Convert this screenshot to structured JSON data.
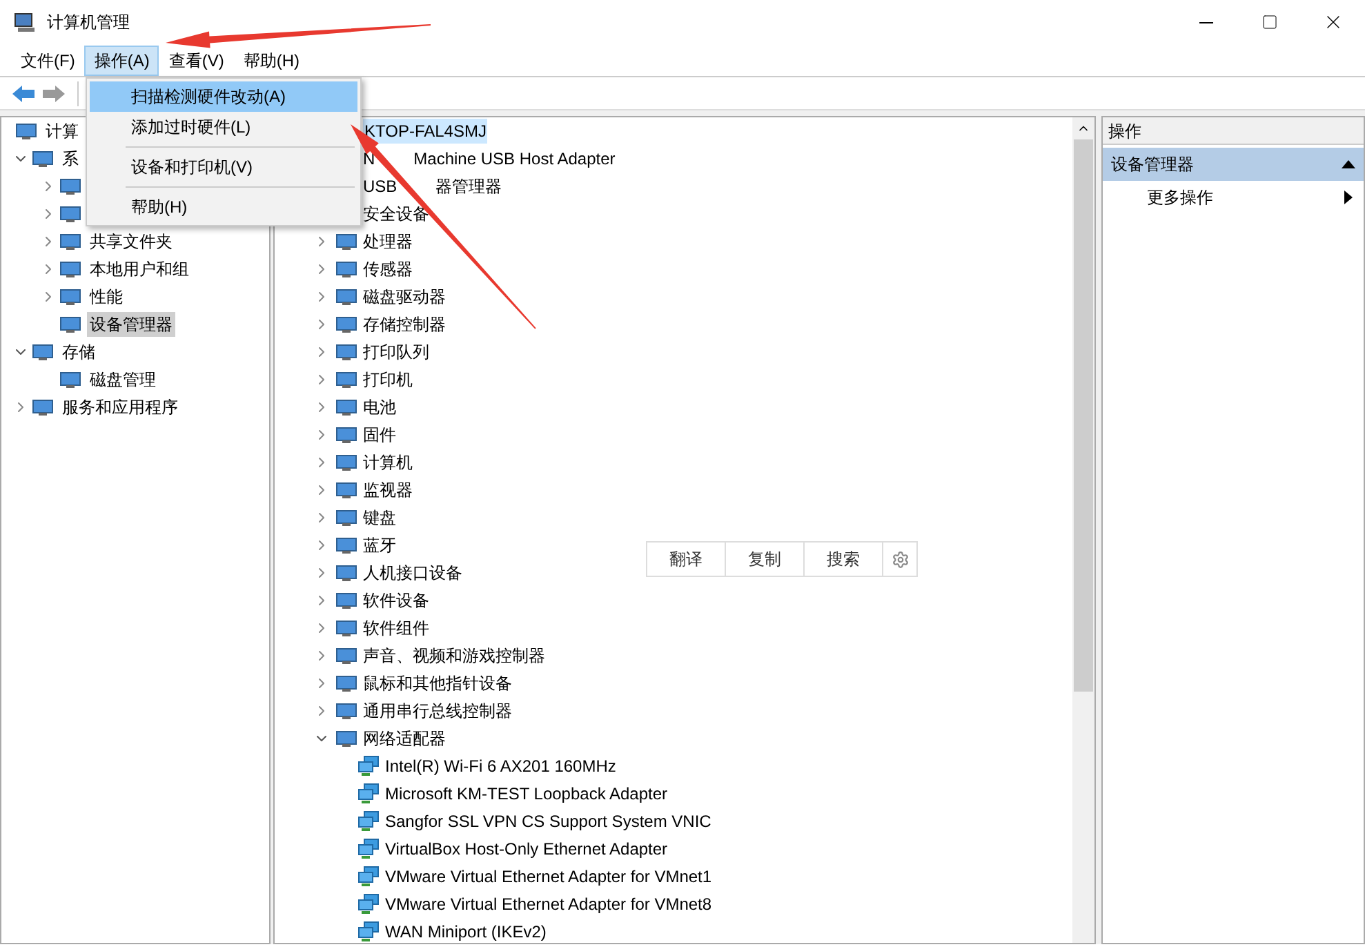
{
  "window": {
    "title": "计算机管理"
  },
  "menu_bar": [
    {
      "label": "文件(F)",
      "selected": false
    },
    {
      "label": "操作(A)",
      "selected": true
    },
    {
      "label": "查看(V)",
      "selected": false
    },
    {
      "label": "帮助(H)",
      "selected": false
    }
  ],
  "dropdown_menu": {
    "items": [
      {
        "kind": "item",
        "label": "扫描检测硬件改动(A)",
        "selected": true
      },
      {
        "kind": "item",
        "label": "添加过时硬件(L)",
        "selected": false
      },
      {
        "kind": "separator"
      },
      {
        "kind": "item",
        "label": "设备和打印机(V)",
        "selected": false
      },
      {
        "kind": "separator"
      },
      {
        "kind": "item",
        "label": "帮助(H)",
        "selected": false
      }
    ]
  },
  "left_tree": [
    {
      "label": "计算",
      "selected": false,
      "children": [
        {
          "label": "系",
          "expanded": true,
          "selected": false,
          "children": [
            {
              "expanded": false
            },
            {
              "expanded": false
            },
            {
              "label": "共享文件夹",
              "expanded": false,
              "selected": false
            },
            {
              "label": "本地用户和组",
              "expanded": false,
              "selected": false
            },
            {
              "label": "性能",
              "expanded": false,
              "selected": false
            },
            {
              "label": "设备管理器",
              "selected": true
            }
          ]
        },
        {
          "label": "存储",
          "expanded": true,
          "selected": false,
          "children": [
            {
              "label": "磁盘管理",
              "selected": false
            }
          ]
        },
        {
          "label": "服务和应用程序",
          "expanded": false,
          "selected": false
        }
      ]
    }
  ],
  "device_tree": {
    "root": {
      "label": "KTOP-FAL4SMJ",
      "selected": true
    },
    "categories": [
      {
        "label_parts": [
          "N",
          "Machine USB Host Adapter"
        ]
      },
      {
        "label_parts": [
          "USB",
          "器管理器"
        ]
      },
      {
        "label": "安全设备"
      },
      {
        "label": "处理器",
        "expanded": false
      },
      {
        "label": "传感器",
        "expanded": false
      },
      {
        "label": "磁盘驱动器",
        "expanded": false
      },
      {
        "label": "存储控制器",
        "expanded": false
      },
      {
        "label": "打印队列",
        "expanded": false
      },
      {
        "label": "打印机",
        "expanded": false
      },
      {
        "label": "电池",
        "expanded": false
      },
      {
        "label": "固件",
        "expanded": false
      },
      {
        "label": "计算机",
        "expanded": false
      },
      {
        "label": "监视器",
        "expanded": false
      },
      {
        "label": "键盘",
        "expanded": false
      },
      {
        "label": "蓝牙",
        "expanded": false
      },
      {
        "label": "人机接口设备",
        "expanded": false
      },
      {
        "label": "软件设备",
        "expanded": false
      },
      {
        "label": "软件组件",
        "expanded": false
      },
      {
        "label": "声音、视频和游戏控制器",
        "expanded": false
      },
      {
        "label": "鼠标和其他指针设备",
        "expanded": false
      },
      {
        "label": "通用串行总线控制器",
        "expanded": false
      },
      {
        "label": "网络适配器",
        "expanded": true,
        "children": [
          {
            "label": "Intel(R) Wi-Fi 6 AX201 160MHz"
          },
          {
            "label": "Microsoft KM-TEST Loopback Adapter"
          },
          {
            "label": "Sangfor SSL VPN CS Support System VNIC"
          },
          {
            "label": "VirtualBox Host-Only Ethernet Adapter"
          },
          {
            "label": "VMware Virtual Ethernet Adapter for VMnet1"
          },
          {
            "label": "VMware Virtual Ethernet Adapter for VMnet8"
          },
          {
            "label": "WAN Miniport (IKEv2)"
          }
        ]
      }
    ]
  },
  "text_popup": {
    "buttons": [
      "翻译",
      "复制",
      "搜索"
    ]
  },
  "actions_pane": {
    "title": "操作",
    "section": {
      "label": "设备管理器",
      "expanded": true
    },
    "items": [
      "更多操作"
    ]
  }
}
